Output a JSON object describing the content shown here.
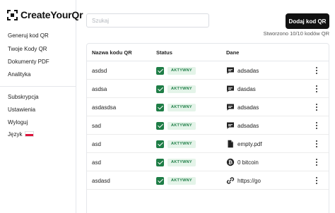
{
  "app": {
    "name": "CreateYourQr"
  },
  "sidebar": {
    "items": [
      {
        "label": "Generuj kod QR"
      },
      {
        "label": "Twoje Kody QR"
      },
      {
        "label": "Dokumenty PDF"
      },
      {
        "label": "Analityka"
      }
    ],
    "secondary": [
      {
        "label": "Subskrypcja"
      },
      {
        "label": "Ustawienia"
      },
      {
        "label": "Wyloguj"
      }
    ],
    "language": {
      "label": "Język",
      "flag": "poland-flag-icon"
    }
  },
  "toolbar": {
    "search_placeholder": "Szukaj",
    "add_button": "Dodaj kod QR",
    "quota": "Stworzono 10/10 kodów QR"
  },
  "table": {
    "headers": {
      "name": "Nazwa kodu QR",
      "status": "Status",
      "data": "Dane"
    },
    "status_color": "#1e7d46",
    "badge_bg": "#e4f4e9",
    "rows": [
      {
        "name": "asdsd",
        "status": "AKTYWNY",
        "icon": "message-icon",
        "data": "adsadas"
      },
      {
        "name": "asdsa",
        "status": "AKTYWNY",
        "icon": "message-icon",
        "data": "dasdas"
      },
      {
        "name": "asdasdsa",
        "status": "AKTYWNY",
        "icon": "message-icon",
        "data": "adsadas"
      },
      {
        "name": "sad",
        "status": "AKTYWNY",
        "icon": "message-icon",
        "data": "adsadas"
      },
      {
        "name": "asd",
        "status": "AKTYWNY",
        "icon": "file-icon",
        "data": "empty.pdf"
      },
      {
        "name": "asd",
        "status": "AKTYWNY",
        "icon": "bitcoin-icon",
        "data": "0 bitcoin"
      },
      {
        "name": "asdasd",
        "status": "AKTYWNY",
        "icon": "link-icon",
        "data": "https://go"
      }
    ]
  }
}
